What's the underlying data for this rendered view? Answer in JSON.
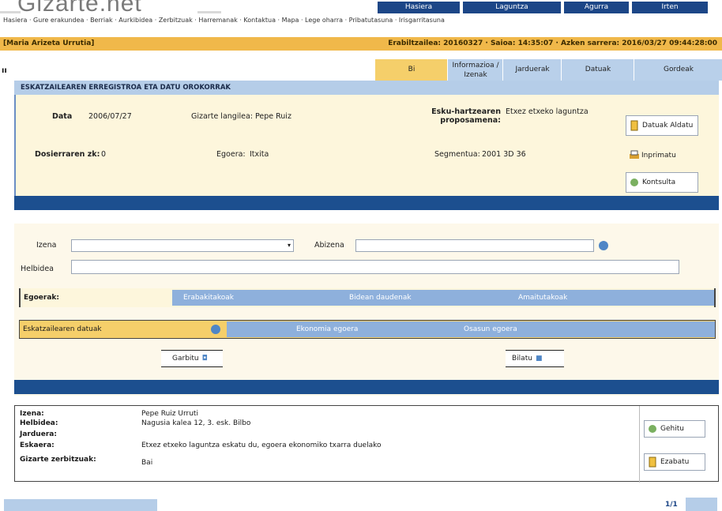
{
  "header": {
    "logo_text": "Gizarte.net",
    "top_nav": [
      "Hasiera",
      "Laguntza",
      "Agurra",
      "Irten"
    ],
    "links": "Hasiera · Gure erakundea · Berriak · Aurkibidea · Zerbitzuak · Harremanak · Kontaktua · Mapa · Lege oharra · Pribatutasuna · Irisgarritasuna",
    "user": "[Maria Arizeta Urrutia]",
    "session": "Erabiltzailea: 20160327 · Saioa: 14:35:07 · Azken sarrera: 2016/03/27 09:44:28:00"
  },
  "left_fragment": "ıı",
  "tabs": [
    "Bi",
    "Informazioa / Izenak",
    "Jarduerak",
    "Datuak",
    "Gordeak"
  ],
  "case": {
    "section_title": "ESKATZAILEAREN ERREGISTROA ETA DATU OROKORRAK",
    "date_label": "Data",
    "date_value": "2006/07/27",
    "ref_label": "Gizarte langilea: Pepe Ruiz",
    "program_label": "Esku-hartzearen proposamena:",
    "program_value": "Etxez etxeko laguntza",
    "file_label": "Dosierraren zk:",
    "file_value": "0",
    "status_label": "Egoera:",
    "status_value": "Itxita",
    "segment_label": "Segmentua:",
    "segment_value": "2001 3D 36",
    "buttons": [
      "Datuak Aldatu",
      "Inprimatu",
      "Kontsulta"
    ]
  },
  "search": {
    "field1_label": "Izena",
    "field2_label": "Abizena",
    "field3_label": "Helbidea",
    "filters_label": "Egoerak:",
    "filter_opts": [
      "Erabakitakoak",
      "Bidean daudenak",
      "Amaitutakoak"
    ],
    "groups_label": "Eskatzailearen datuak",
    "group_opts": [
      "Ekonomia egoera",
      "Osasun egoera"
    ],
    "clear_label": "Garbitu",
    "search_label": "Bilatu"
  },
  "results": {
    "rows": [
      {
        "k": "Izena:",
        "v": "Pepe Ruiz Urruti"
      },
      {
        "k": "Helbidea:",
        "v": "Nagusia kalea 12, 3. esk. Bilbo"
      },
      {
        "k": "Jarduera:",
        "v": ""
      },
      {
        "k": "Eskaera:",
        "v": "Etxez etxeko laguntza eskatu du, egoera ekonomiko txarra duelako"
      },
      {
        "k": "Gizarte zerbitzuak:",
        "v": "Bai"
      }
    ],
    "buttons": [
      "Gehitu",
      "Ezabatu"
    ]
  },
  "footer": {
    "page": "1/1"
  },
  "colors": {
    "navy": "#1c4687",
    "gold": "#f0b84a",
    "lightblue": "#b5cde8",
    "cream": "#fdf6dc"
  }
}
